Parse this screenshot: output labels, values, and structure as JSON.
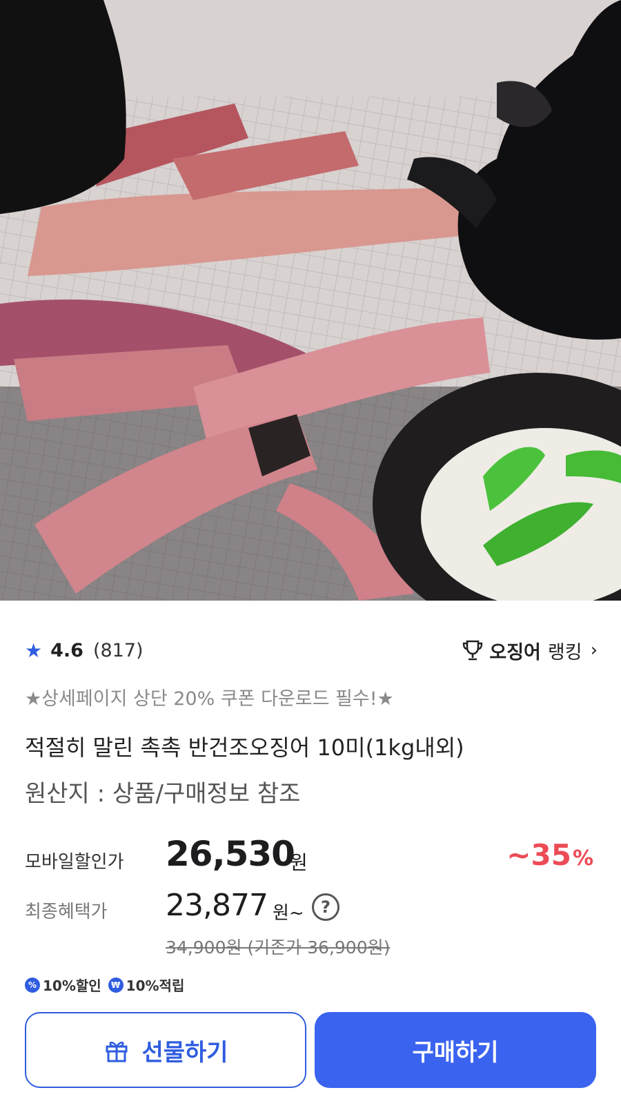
{
  "product": {
    "rating": "4.6",
    "review_count": "(817)",
    "ranking_keyword": "오징어",
    "ranking_label": "랭킹",
    "coupon_note": "★상세페이지 상단 20% 쿠폰 다운로드 필수!★",
    "title": "적절히 말린 촉촉 반건조오징어 10미(1kg내외)",
    "origin": "원산지 : 상품/구매정보 참조"
  },
  "pricing": {
    "mobile_label": "모바일할인가",
    "mobile_price": "26,530",
    "mobile_unit": "원",
    "discount_prefix": "~",
    "discount_value": "35",
    "discount_pct": "%",
    "final_label": "최종혜택가",
    "final_price": "23,877",
    "final_unit": "원~",
    "help_glyph": "?",
    "strike_text": "34,900원 (기존가 36,900원)"
  },
  "badges": [
    {
      "icon_glyph": "%",
      "label": "10%할인"
    },
    {
      "icon_glyph": "₩",
      "label": "10%적립"
    }
  ],
  "actions": {
    "gift_label": "선물하기",
    "buy_label": "구매하기"
  },
  "colors": {
    "accent": "#3a63f0",
    "discount": "#ec4b56"
  },
  "icons": {
    "rating": "star-icon",
    "ranking": "trophy-icon",
    "gift": "gift-icon",
    "help": "question-circle-icon"
  }
}
